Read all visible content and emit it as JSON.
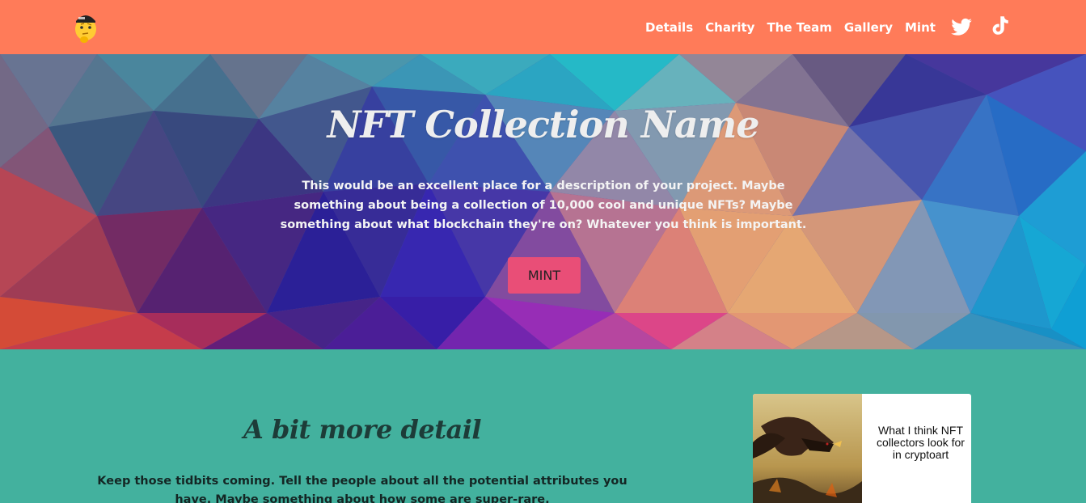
{
  "nav": {
    "links": [
      "Details",
      "Charity",
      "The Team",
      "Gallery",
      "Mint"
    ],
    "logo_icon": "thinking-face-cap-icon",
    "social": [
      "twitter-icon",
      "tiktok-icon"
    ]
  },
  "hero": {
    "title": "NFT Collection Name",
    "description": "This would be an excellent place for a description of your project. Maybe something about being a collection of 10,000 cool and unique NFTs? Maybe something about what blockchain they're on? Whatever you think is important.",
    "button_label": "MINT"
  },
  "detail": {
    "title": "A bit more detail",
    "text": "Keep those tidbits coming. Tell the people about all the potential attributes you have. Maybe something about how some are super-rare."
  },
  "card": {
    "caption": "What I think NFT collectors look for in cryptoart"
  },
  "colors": {
    "navbar": "#ff7b59",
    "section_bg": "#43b19e",
    "mint_button": "#e94e77"
  }
}
